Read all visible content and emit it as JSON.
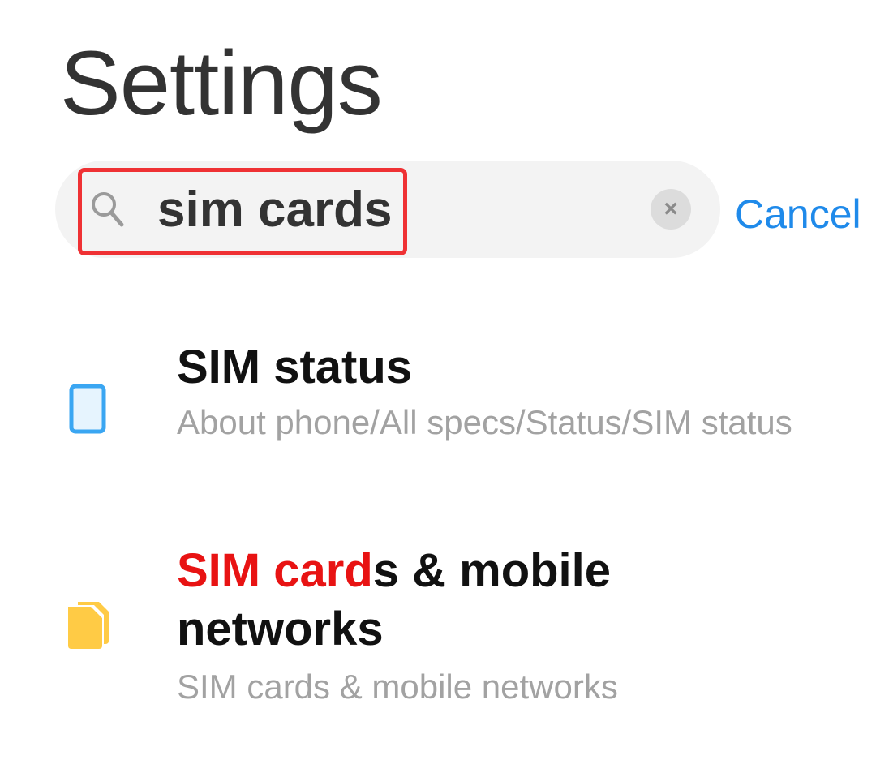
{
  "header": {
    "title": "Settings"
  },
  "search": {
    "query": "sim cards",
    "cancel_label": "Cancel",
    "clear_symbol": "×"
  },
  "results": [
    {
      "icon": "sim-card-icon",
      "icon_color": "#3aa6f2",
      "title": "SIM status",
      "path": "About phone/All specs/Status/SIM status"
    },
    {
      "icon": "sim-cards-stack-icon",
      "icon_color": "#ffcb45",
      "title_match": "SIM card",
      "title_rest": "s & mobile networks",
      "path": "SIM cards & mobile networks"
    }
  ],
  "colors": {
    "accent": "#1f8aea",
    "match_highlight": "#e81313",
    "annotation_box": "#ef3134"
  }
}
